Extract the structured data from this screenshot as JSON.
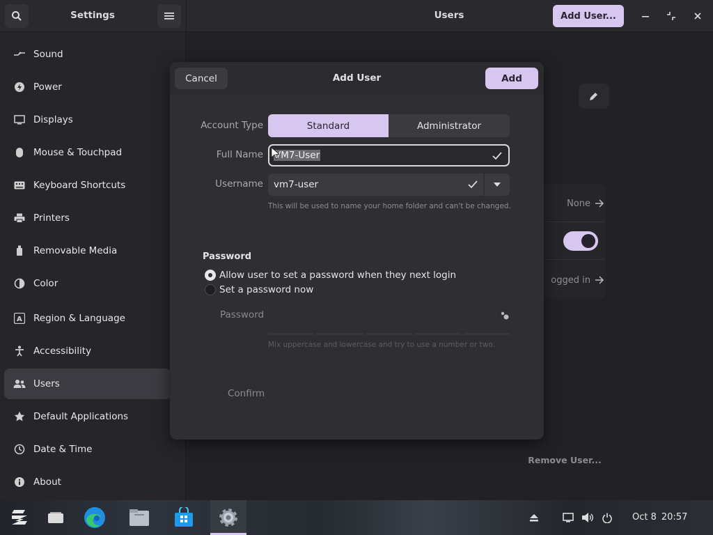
{
  "header": {
    "sidebar_title": "Settings",
    "main_title": "Users",
    "add_user_label": "Add User..."
  },
  "sidebar": {
    "items": [
      {
        "label": "Sound",
        "icon": "speaker-icon"
      },
      {
        "label": "Power",
        "icon": "power-icon"
      },
      {
        "label": "Displays",
        "icon": "display-icon"
      },
      {
        "label": "Mouse & Touchpad",
        "icon": "mouse-icon"
      },
      {
        "label": "Keyboard Shortcuts",
        "icon": "keyboard-icon"
      },
      {
        "label": "Printers",
        "icon": "printer-icon"
      },
      {
        "label": "Removable Media",
        "icon": "usb-icon"
      },
      {
        "label": "Color",
        "icon": "palette-icon"
      },
      {
        "label": "Region & Language",
        "icon": "language-icon"
      },
      {
        "label": "Accessibility",
        "icon": "accessibility-icon"
      },
      {
        "label": "Users",
        "icon": "users-icon"
      },
      {
        "label": "Default Applications",
        "icon": "star-icon"
      },
      {
        "label": "Date & Time",
        "icon": "clock-icon"
      },
      {
        "label": "About",
        "icon": "info-icon"
      }
    ],
    "active": "Users"
  },
  "main": {
    "language_value": "None",
    "autologin_label": "ogged in",
    "remove_user_label": "Remove User..."
  },
  "dialog": {
    "title": "Add User",
    "cancel_label": "Cancel",
    "add_label": "Add",
    "account_type_label": "Account Type",
    "account_types": [
      "Standard",
      "Administrator"
    ],
    "account_type_selected": "Standard",
    "full_name_label": "Full Name",
    "full_name_value": "VM7-User",
    "username_label": "Username",
    "username_value": "vm7-user",
    "username_hint": "This will be used to name your home folder and can't be changed.",
    "password_section": "Password",
    "password_options": [
      "Allow user to set a password when they next login",
      "Set a password now"
    ],
    "password_selected": 0,
    "password_placeholder": "Password",
    "password_hint": "Mix uppercase and lowercase and try to use a number or two.",
    "confirm_placeholder": "Confirm"
  },
  "taskbar": {
    "date": "Oct 8",
    "time": "20:57"
  },
  "colors": {
    "accent": "#d7c6ef",
    "accent_text": "#2a2430",
    "window_bg": "#222226",
    "dialog_bg": "#2e2e33"
  }
}
